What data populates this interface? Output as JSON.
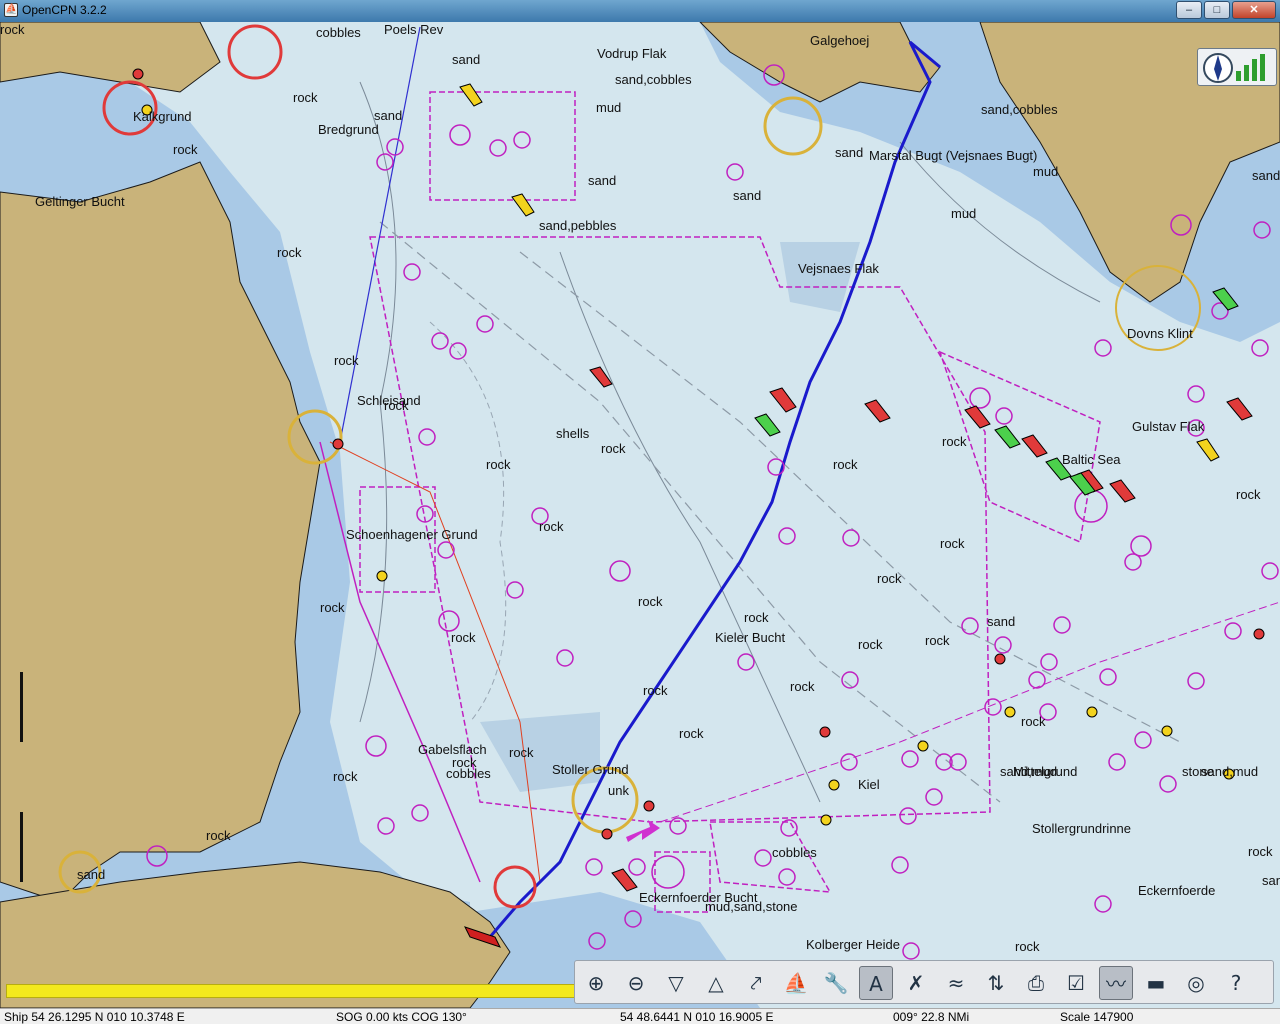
{
  "window": {
    "title": "OpenCPN 3.2.2",
    "app_icon": "opencpn-icon",
    "btn_minimize": "–",
    "btn_maximize": "□",
    "btn_close": "✕"
  },
  "chart_labels": [
    "Poels Rev",
    "cobbles",
    "sand",
    "Vodrup Flak",
    "Galgehoej",
    "sand,cobbles",
    "mud",
    "rock",
    "Kalkgrund",
    "sand",
    "Bredgrund",
    "rock",
    "sand,cobbles",
    "sand",
    "Marstal Bugt (Vejsnaes Bugt)",
    "mud",
    "sand",
    "mud",
    "Geltinger Bucht",
    "sand,pebbles",
    "sand",
    "rock",
    "Vejsnaes Flak",
    "sand",
    "Dovns Klint",
    "rock",
    "Schleisand",
    "rock",
    "shells",
    "rock",
    "rock",
    "Gulstav Flak",
    "rock",
    "rock",
    "rock",
    "Baltic Sea",
    "rock",
    "rock",
    "Schoenhagener Grund",
    "rock",
    "rock",
    "rock",
    "rock",
    "rock",
    "Kieler Bucht",
    "rock",
    "sand",
    "rock",
    "rock",
    "rock",
    "rock",
    "sand,mud",
    "rock",
    "Gabelsflach",
    "rock",
    "Stoller Grund",
    "rock",
    "cobbles",
    "Stollergrundrinne",
    "rock",
    "Mittelgrund",
    "sand,mud",
    "stone",
    "unk",
    "Kiel",
    "cobbles",
    "rock",
    "Eckernfoerder Bucht",
    "rock",
    "sand",
    "Eckernfoerde",
    "mud,sand,stone",
    "Kolberger Heide",
    "rock",
    "sand,mud",
    "rock"
  ],
  "toolbar": [
    {
      "name": "zoom-in-icon",
      "glyph": "⊕",
      "active": false
    },
    {
      "name": "zoom-out-icon",
      "glyph": "⊖",
      "active": false
    },
    {
      "name": "chart-scale-down-icon",
      "glyph": "▽",
      "active": false
    },
    {
      "name": "chart-scale-up-icon",
      "glyph": "△",
      "active": false
    },
    {
      "name": "route-icon",
      "glyph": "⤤",
      "active": false
    },
    {
      "name": "auto-follow-ship-icon",
      "glyph": "⛵",
      "active": false
    },
    {
      "name": "settings-icon",
      "glyph": "🔧",
      "active": false
    },
    {
      "name": "text-toggle-icon",
      "glyph": "A",
      "active": true
    },
    {
      "name": "current-tide-icon",
      "glyph": "✗",
      "active": false
    },
    {
      "name": "tide-icon",
      "glyph": "≈",
      "active": false
    },
    {
      "name": "current-icon",
      "glyph": "⇅",
      "active": false
    },
    {
      "name": "print-icon",
      "glyph": "⎙",
      "active": false
    },
    {
      "name": "route-manager-icon",
      "glyph": "☑",
      "active": false
    },
    {
      "name": "track-icon",
      "glyph": "〰",
      "active": true
    },
    {
      "name": "color-scheme-icon",
      "glyph": "▬",
      "active": false
    },
    {
      "name": "mob-icon",
      "glyph": "◎",
      "active": false
    },
    {
      "name": "help-icon",
      "glyph": "?",
      "active": false
    }
  ],
  "status": {
    "ship": "Ship 54 26.1295 N   010 10.3748 E",
    "sog": "SOG 0.00 kts   COG 130°",
    "cursor": "54 48.6441 N   010 16.9005 E",
    "bearing": "009°   22.8 NMi",
    "scale": "Scale 147900"
  },
  "colors": {
    "land": "#c9b37a",
    "shallow": "#a9c9e6",
    "deep": "#d4e6ee",
    "route": "#1a1acc",
    "magenta": "#c020c0"
  }
}
